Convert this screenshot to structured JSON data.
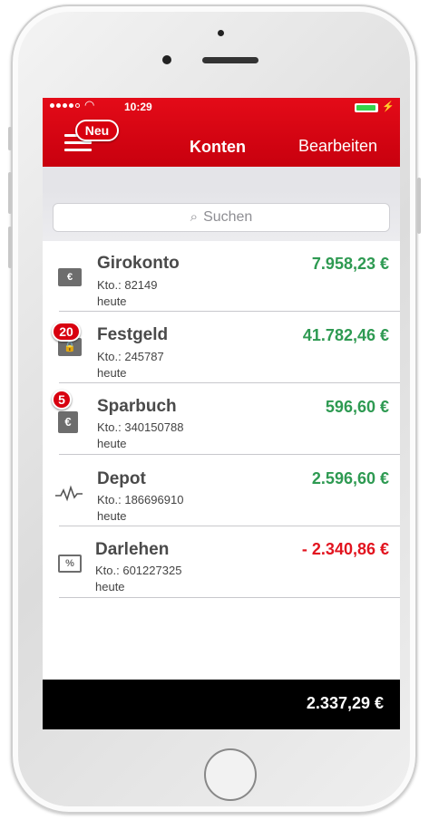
{
  "status": {
    "time": "10:29"
  },
  "nav": {
    "new_badge": "Neu",
    "title": "Konten",
    "edit": "Bearbeiten"
  },
  "search": {
    "placeholder": "Suchen"
  },
  "accounts": [
    {
      "name": "Girokonto",
      "kto": "Kto.: 82149",
      "date": "heute",
      "amount": "7.958,23 €",
      "badge": "",
      "icon": "giro-icon"
    },
    {
      "name": "Festgeld",
      "kto": "Kto.: 245787",
      "date": "heute",
      "amount": "41.782,46 €",
      "badge": "20",
      "icon": "festgeld-lock-icon"
    },
    {
      "name": "Sparbuch",
      "kto": "Kto.: 340150788",
      "date": "heute",
      "amount": "596,60 €",
      "badge": "5",
      "icon": "sparbuch-euro-icon"
    },
    {
      "name": "Depot",
      "kto": "Kto.: 186696910",
      "date": "heute",
      "amount": "2.596,60 €",
      "badge": "",
      "icon": "depot-chart-icon"
    },
    {
      "name": "Darlehen",
      "kto": "Kto.: 601227325",
      "date": "heute",
      "amount": "- 2.340,86 €",
      "badge": "",
      "icon": "darlehen-percent-icon"
    }
  ],
  "footer": {
    "total": "2.337,29 €"
  },
  "colors": {
    "brand": "#d8000f",
    "positive": "#2e9a52",
    "negative": "#e2141f"
  }
}
